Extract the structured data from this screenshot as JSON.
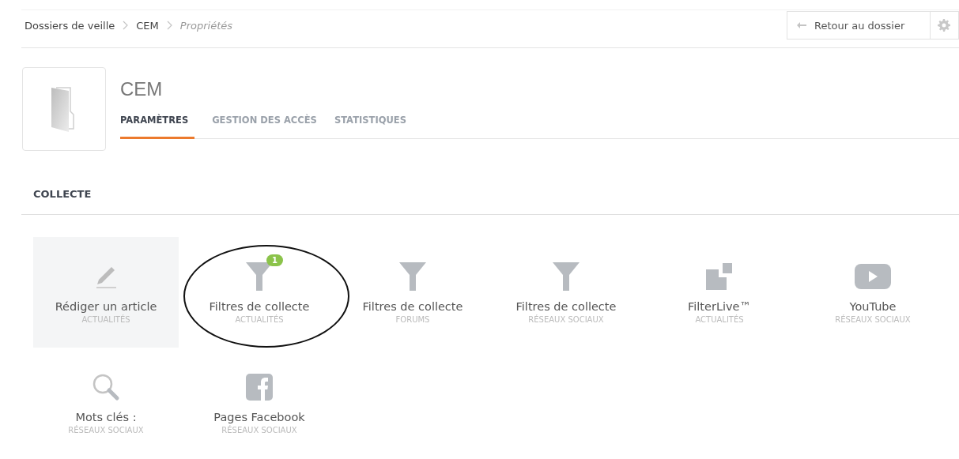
{
  "breadcrumb": [
    {
      "label": "Dossiers de veille",
      "current": false
    },
    {
      "label": "CEM",
      "current": false
    },
    {
      "label": "Propriétés",
      "current": true
    }
  ],
  "back_button": {
    "label": "Retour au dossier"
  },
  "folder": {
    "title": "CEM"
  },
  "tabs": [
    {
      "label": "PARAMÈTRES",
      "selected": true
    },
    {
      "label": "GESTION DES ACCÈS",
      "selected": false
    },
    {
      "label": "STATISTIQUES",
      "selected": false
    }
  ],
  "section": {
    "title": "COLLECTE"
  },
  "sources": [
    {
      "kind": "pencil",
      "label": "Rédiger un article",
      "category": "ACTUALITÉS",
      "highlighted": true,
      "circled": false
    },
    {
      "kind": "funnel",
      "label": "Filtres de collecte",
      "category": "ACTUALITÉS",
      "badge": "1",
      "highlighted": false,
      "circled": true
    },
    {
      "kind": "funnel",
      "label": "Filtres de collecte",
      "category": "FORUMS",
      "highlighted": false,
      "circled": false
    },
    {
      "kind": "funnel",
      "label": "Filtres de collecte",
      "category": "RÉSEAUX SOCIAUX",
      "highlighted": false,
      "circled": false
    },
    {
      "kind": "filterlive",
      "label": "FilterLive™",
      "category": "ACTUALITÉS",
      "highlighted": false,
      "circled": false
    },
    {
      "kind": "youtube",
      "label": "YouTube",
      "category": "RÉSEAUX SOCIAUX",
      "highlighted": false,
      "circled": false
    },
    {
      "kind": "search",
      "label": "Mots clés :",
      "category": "RÉSEAUX SOCIAUX",
      "highlighted": false,
      "circled": false
    },
    {
      "kind": "facebook",
      "label": "Pages Facebook",
      "category": "RÉSEAUX SOCIAUX",
      "highlighted": false,
      "circled": false
    }
  ]
}
